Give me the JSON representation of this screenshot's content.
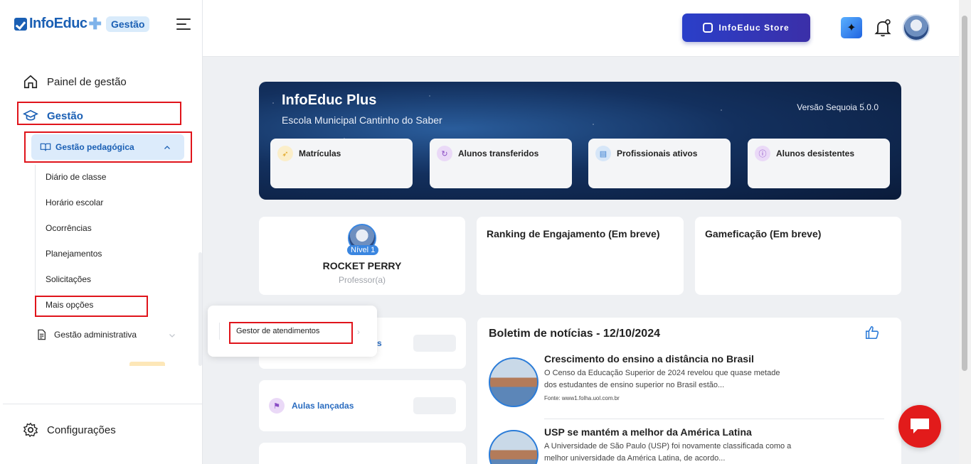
{
  "app": {
    "logo_text": "InfoEduc",
    "logo_plus": "✚",
    "badge": "Gestão"
  },
  "sidebar": {
    "painel": "Painel de gestão",
    "gestao": "Gestão",
    "gestao_pedagogica": "Gestão pedagógica",
    "sub_items": [
      "Diário de classe",
      "Horário escolar",
      "Ocorrências",
      "Planejamentos",
      "Solicitações",
      "Mais opções"
    ],
    "gestao_administrativa": "Gestão administrativa",
    "configuracoes": "Configurações"
  },
  "header": {
    "store_label": "InfoEduc Store",
    "spark_icon": "sparkle-icon",
    "bell_icon": "bell-icon"
  },
  "banner": {
    "title": "InfoEduc Plus",
    "school": "Escola Municipal Cantinho do Saber",
    "version": "Versão Sequoia 5.0.0",
    "stats": [
      {
        "label": "Matrículas",
        "icon": "rocket-icon",
        "color": "#f2c14e"
      },
      {
        "label": "Alunos transferidos",
        "icon": "refresh-icon",
        "color": "#9b59d0"
      },
      {
        "label": "Profissionais ativos",
        "icon": "badge-icon",
        "color": "#4a90d9"
      },
      {
        "label": "Alunos desistentes",
        "icon": "info-icon",
        "color": "#9b59d0"
      }
    ]
  },
  "profile": {
    "level": "Nível 1",
    "name": "ROCKET PERRY",
    "role": "Professor(a)"
  },
  "cards": {
    "ranking": "Ranking de Engajamento (Em breve)",
    "gamificacao": "Gameficação (Em breve)",
    "aulas": "Aulas lançadas",
    "partial_label": "s"
  },
  "news": {
    "title": "Boletim de notícias - 12/10/2024",
    "items": [
      {
        "headline": "Crescimento do ensino a distância no Brasil",
        "body_l1": "O Censo da Educação Superior de 2024 revelou que quase metade",
        "body_l2": "dos estudantes de ensino superior no Brasil estão...",
        "source": "Fonte: www1.folha.uol.com.br"
      },
      {
        "headline": "USP se mantém a melhor da América Latina",
        "body_l1": "A Universidade de São Paulo (USP) foi novamente classificada como a",
        "body_l2": "melhor universidade da América Latina, de acordo..."
      }
    ]
  },
  "popup": {
    "label": "Gestor de atendimentos"
  },
  "colors": {
    "primary": "#1a5fb4",
    "highlight": "#e0141b",
    "chat": "#e21b1b"
  }
}
